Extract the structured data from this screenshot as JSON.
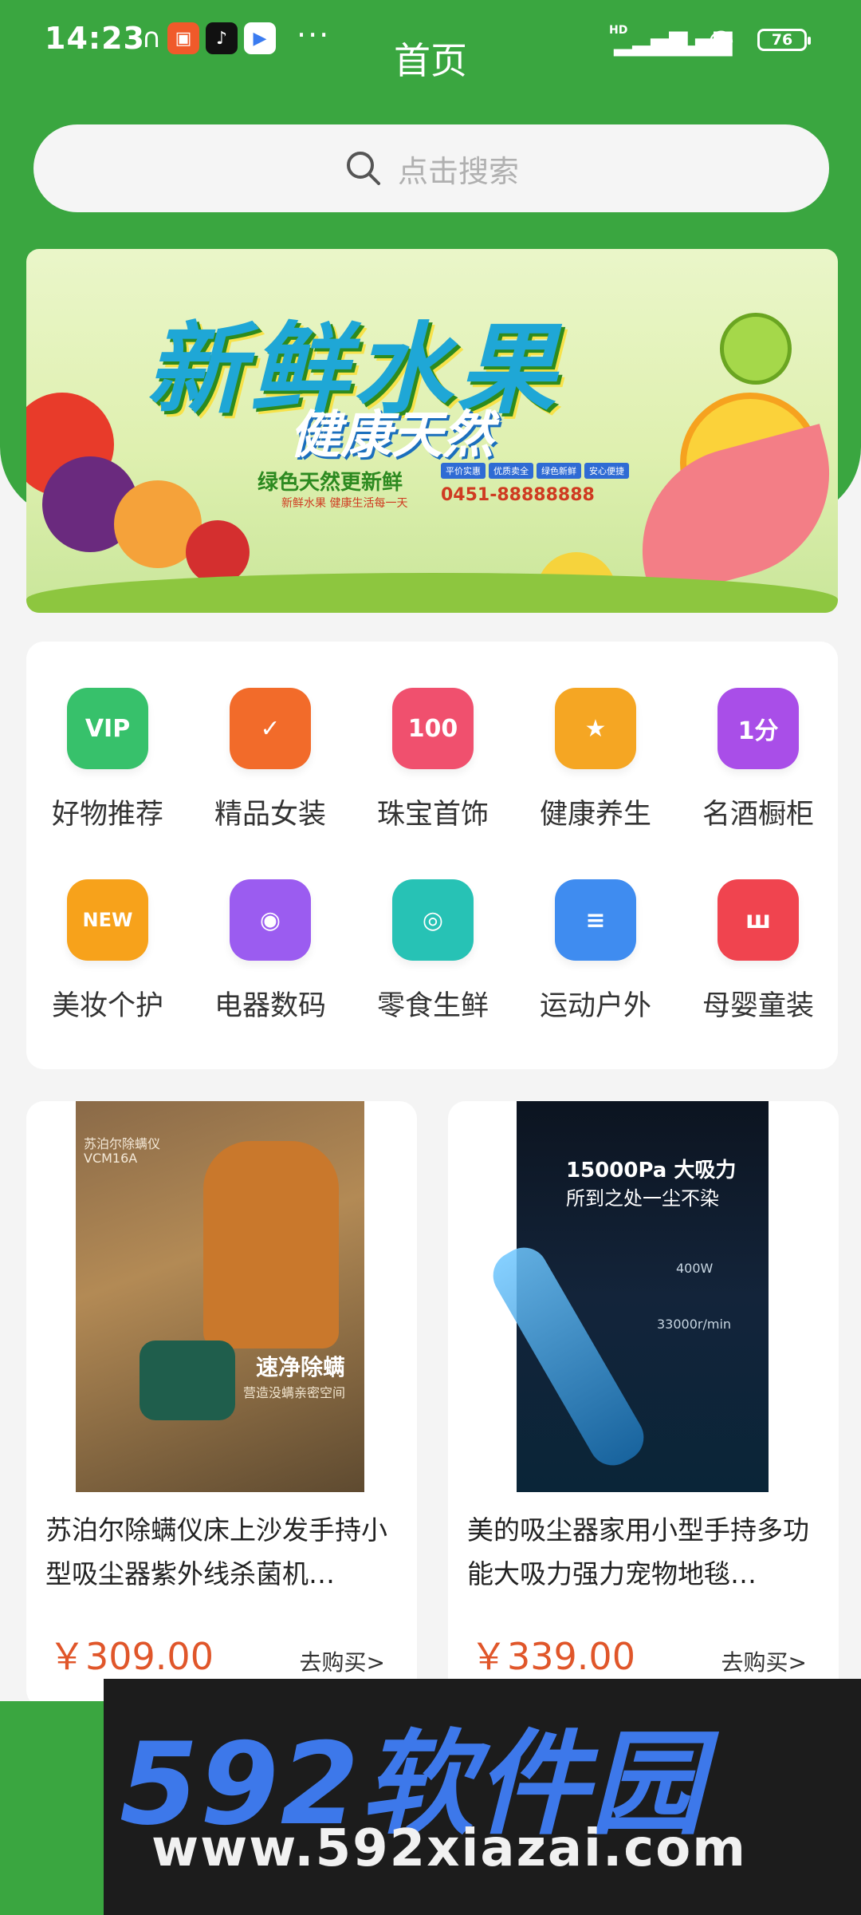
{
  "status_bar": {
    "time": "14:23",
    "dots": "···",
    "signal_label": "HD",
    "battery": "76"
  },
  "header": {
    "title": "首页"
  },
  "search": {
    "placeholder": "点击搜索"
  },
  "banner": {
    "title": "新鲜水果",
    "subtitle": "健康天然",
    "tagline": "绿色天然更新鲜",
    "tagline2": "新鲜水果 健康生活每一天",
    "phone": "0451-88888888",
    "pills": [
      "平价实惠",
      "优质卖全",
      "绿色新鲜",
      "安心便捷"
    ]
  },
  "categories": [
    {
      "label": "好物推荐",
      "icon": "vip-icon",
      "text": "VIP",
      "color": "#37c16b"
    },
    {
      "label": "精品女装",
      "icon": "check-bag-icon",
      "text": "✓",
      "color": "#f26b2a"
    },
    {
      "label": "珠宝首饰",
      "icon": "hundred-icon",
      "text": "100",
      "color": "#f0506e"
    },
    {
      "label": "健康养生",
      "icon": "medal-icon",
      "text": "★",
      "color": "#f5a623"
    },
    {
      "label": "名酒橱柜",
      "icon": "money-bag-icon",
      "text": "1分",
      "color": "#a94ee8"
    },
    {
      "label": "美妆个护",
      "icon": "new-badge-icon",
      "text": "NEW",
      "color": "#f7a21b"
    },
    {
      "label": "电器数码",
      "icon": "planet-icon",
      "text": "◉",
      "color": "#9b5cf0"
    },
    {
      "label": "零食生鲜",
      "icon": "ring-icon",
      "text": "◎",
      "color": "#27c2b5"
    },
    {
      "label": "运动户外",
      "icon": "list-icon",
      "text": "≡",
      "color": "#3f8cf0"
    },
    {
      "label": "母婴童装",
      "icon": "basket-icon",
      "text": "ш",
      "color": "#f0444f"
    }
  ],
  "products": [
    {
      "name": "苏泊尔除螨仪床上沙发手持小型吸尘器紫外线杀菌机…",
      "price": "￥309.00",
      "buy": "去购买>",
      "img_text_1": "速净除螨",
      "img_text_2": "营造没螨亲密空间",
      "img_brand": "苏泊尔除螨仪",
      "img_model": "VCM16A"
    },
    {
      "name": "美的吸尘器家用小型手持多功能大吸力强力宠物地毯…",
      "price": "￥339.00",
      "buy": "去购买>",
      "img_text_1": "15000Pa 大吸力",
      "img_text_2": "所到之处一尘不染",
      "img_spec_1": "400W",
      "img_spec_2": "33000r/min"
    }
  ],
  "watermark": {
    "logo": "592软件园",
    "url": "www.592xiazai.com"
  },
  "colors": {
    "primary": "#3aa640",
    "price": "#e0562a"
  }
}
